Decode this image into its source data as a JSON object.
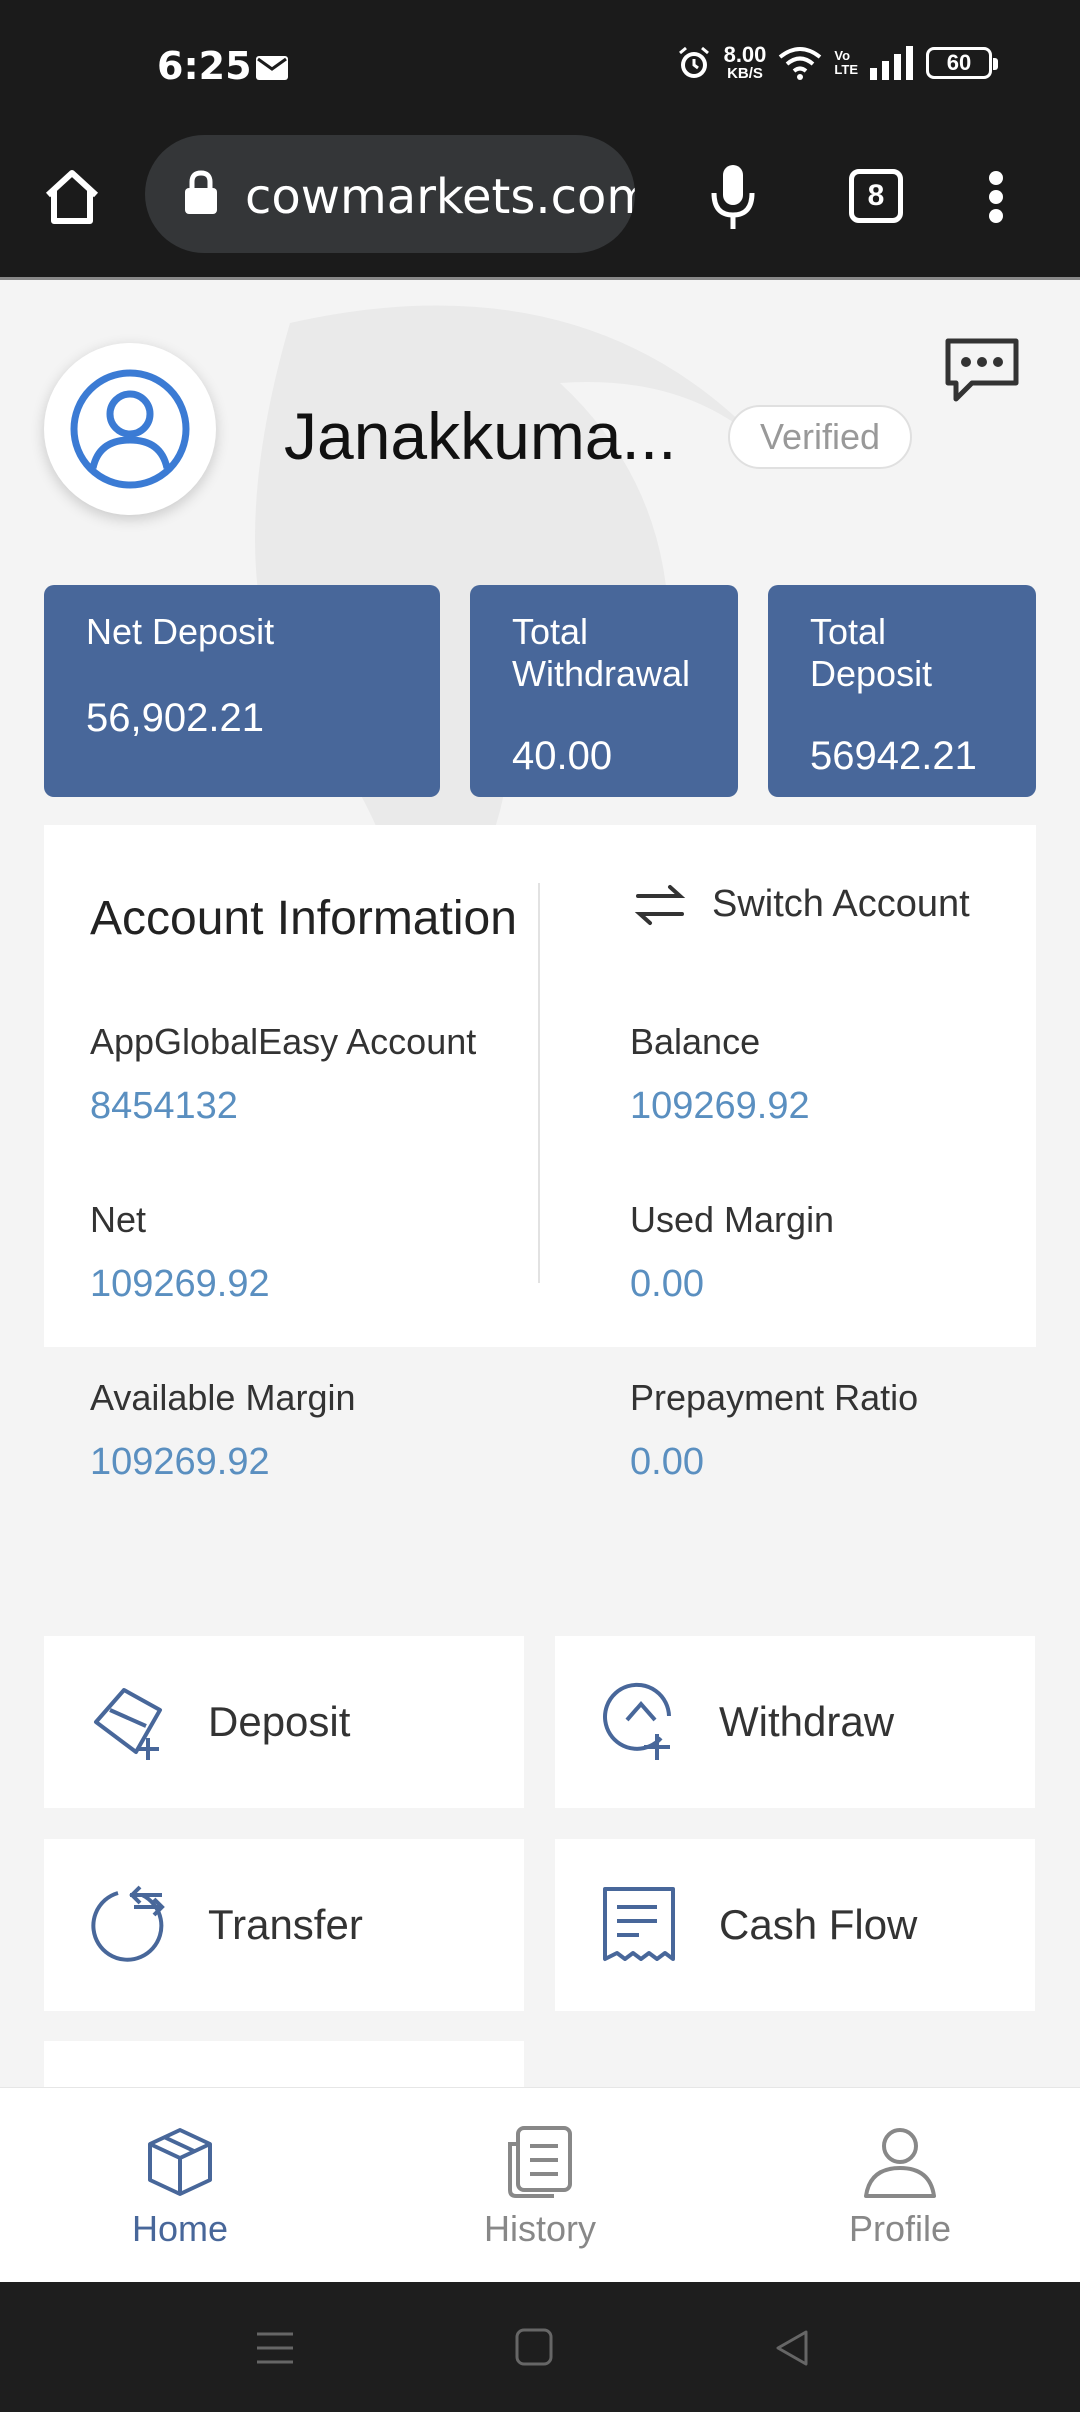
{
  "status_bar": {
    "time": "6:25",
    "net_speed_value": "8.00",
    "net_speed_unit": "KB/S",
    "volte_line1": "Vo",
    "volte_line2": "LTE",
    "battery": "60"
  },
  "browser": {
    "url": "cowmarkets.com",
    "tab_count": "8"
  },
  "profile": {
    "name": "Janakkuma...",
    "verified_label": "Verified"
  },
  "stats": {
    "net_deposit_label": "Net Deposit",
    "net_deposit_value": "56,902.21",
    "total_withdrawal_label_1": "Total",
    "total_withdrawal_label_2": "Withdrawal",
    "total_withdrawal_value": "40.00",
    "total_deposit_label_1": "Total",
    "total_deposit_label_2": "Deposit",
    "total_deposit_value": "56942.21"
  },
  "account": {
    "title": "Account Information",
    "switch_label": "Switch Account",
    "fields": [
      {
        "label": "AppGlobalEasy Account",
        "value": "8454132"
      },
      {
        "label": "Balance",
        "value": "109269.92"
      },
      {
        "label": "Net",
        "value": "109269.92"
      },
      {
        "label": "Used Margin",
        "value": "0.00"
      },
      {
        "label": "Available Margin",
        "value": "109269.92"
      },
      {
        "label": "Prepayment Ratio",
        "value": "0.00"
      }
    ]
  },
  "actions": {
    "deposit": "Deposit",
    "withdraw": "Withdraw",
    "transfer": "Transfer",
    "cash_flow": "Cash Flow"
  },
  "bottom_nav": {
    "home": "Home",
    "history": "History",
    "profile": "Profile"
  },
  "colors": {
    "accent": "#48679a",
    "value_blue": "#5a8fc0",
    "avatar_blue": "#3b7bd4"
  }
}
